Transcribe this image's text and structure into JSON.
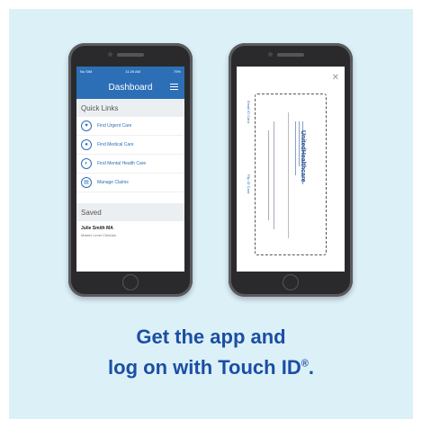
{
  "left_phone": {
    "status": {
      "carrier": "No SIM",
      "time": "11:26 AM",
      "battery": "79%"
    },
    "header": {
      "title": "Dashboard"
    },
    "quick_links": {
      "heading": "Quick Links",
      "items": [
        {
          "icon": "heart-icon",
          "label": "Find Urgent Care"
        },
        {
          "icon": "doctor-icon",
          "label": "Find Medical Care"
        },
        {
          "icon": "head-icon",
          "label": "Find Mental Health Care"
        },
        {
          "icon": "document-icon",
          "label": "Manage Claims"
        }
      ]
    },
    "saved": {
      "heading": "Saved",
      "name": "Julie Smith MA",
      "title": "Master Level Clinician"
    }
  },
  "right_phone": {
    "card": {
      "brand": "UnitedHealthcare",
      "email_label": "Email ID Card",
      "flip_label": "Flip ID Card"
    }
  },
  "headline": {
    "line1": "Get the app and",
    "line2": "log on with Touch ID",
    "mark": "®",
    "end": "."
  },
  "colors": {
    "background": "#dcf0f8",
    "brand_blue": "#2c6fb7",
    "headline": "#1b4fa3"
  }
}
